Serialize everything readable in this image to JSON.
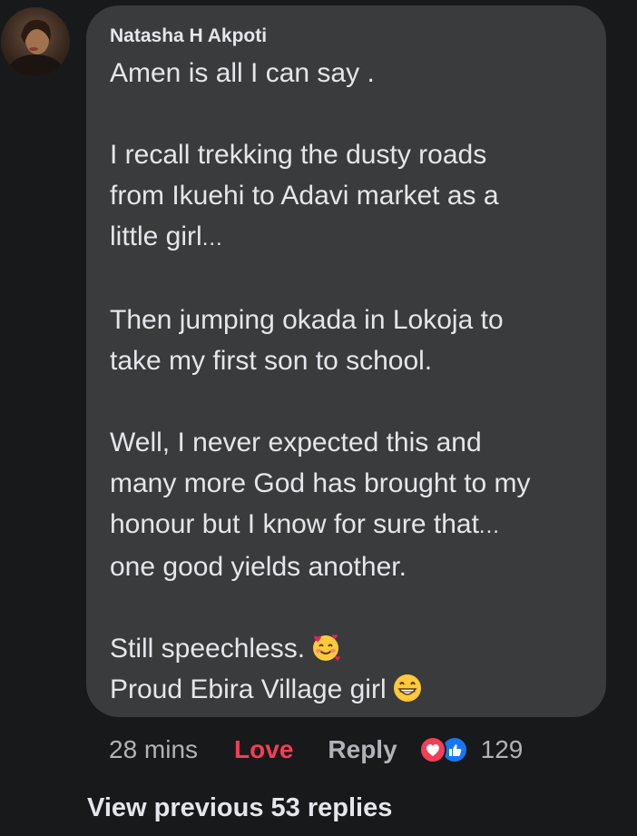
{
  "comment": {
    "author": "Natasha H Akpoti",
    "lines": [
      "Amen is all I can say .",
      "",
      "I recall trekking the dusty roads",
      "from Ikuehi to Adavi market as a",
      "little girl",
      "",
      "Then jumping okada in Lokoja to",
      "take my first son to school.",
      "",
      "Well, I never expected this and",
      "many more God has brought to my",
      "honour but I know for sure that",
      "one good yields another.",
      "",
      "Still speechless.",
      "Proud Ebira Village girl"
    ],
    "ellipsis": "..."
  },
  "actions": {
    "time": "28 mins",
    "love_label": "Love",
    "reply_label": "Reply",
    "reaction_count": "129"
  },
  "view_previous": "View previous 53 replies",
  "icons": {
    "avatar": "profile-photo",
    "reaction_love": "heart-reaction-icon",
    "reaction_like": "thumbs-up-reaction-icon",
    "emoji_1": "smiling-face-with-hearts-emoji",
    "emoji_2": "grinning-face-emoji"
  },
  "colors": {
    "background": "#18191a",
    "bubble": "#3a3b3c",
    "text": "#e4e6eb",
    "secondary": "#b0b3b8",
    "love": "#f33e58",
    "like": "#1877f2"
  }
}
